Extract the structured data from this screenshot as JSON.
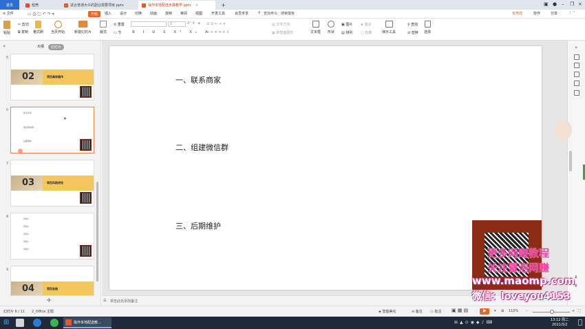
{
  "tabs": {
    "home": "首页",
    "tab1": "稻壳",
    "tab2": "适合普通大众的副业需要项目.pptx",
    "tab3": "操作本地配送步骤教学.pptx",
    "new_tab": "+"
  },
  "menu": {
    "file": "≡ 文件",
    "items": [
      "开始",
      "插入",
      "设计",
      "切换",
      "动画",
      "放映",
      "审阅",
      "视图",
      "开发工具",
      "会员专享"
    ],
    "search": "查找命令、搜索模板",
    "right": [
      "有修改",
      "协作",
      "分享"
    ]
  },
  "ribbon": {
    "paste": "粘贴",
    "cut": "剪切",
    "copy": "复制",
    "format_painter": "格式刷",
    "start_from_current": "当页开始",
    "new_slide": "新建幻灯片",
    "layout": "版式",
    "section": "节",
    "reset": "重置",
    "text_box": "文本框",
    "shape": "形状",
    "arrange": "排列",
    "picture": "图片",
    "fill": "填充",
    "outline": "轮廓",
    "presentation_tools": "演示工具",
    "find": "查找",
    "replace": "替换",
    "select": "选择",
    "font_placeholder": "",
    "size_placeholder": "0",
    "text_to_smartart": "转智能图形"
  },
  "panel": {
    "tab_outline": "大纲",
    "tab_slides": "幻灯片",
    "slides": [
      {
        "num": "5",
        "big": "02",
        "title": "项目具体操作"
      },
      {
        "num": "6",
        "lines": [
          "联系商家",
          "组建微信群",
          "后期维护"
        ]
      },
      {
        "num": "7",
        "big": "03",
        "title": "项目风险评估"
      },
      {
        "num": "8",
        "lines": [
          "风险1",
          "风险2",
          "风险3",
          "风险4",
          "风险5"
        ]
      },
      {
        "num": "9",
        "big": "04",
        "title": "项目总结"
      }
    ],
    "add": "+"
  },
  "slide": {
    "line1": "一、联系商家",
    "line2": "二、组建微信群",
    "line3": "三、后期维护"
  },
  "notes": {
    "placeholder": "单击此处添加备注"
  },
  "status": {
    "slide_index": "幻灯片 6 / 11",
    "theme": "2_Office 主题",
    "smart_beautify": "智能美化",
    "notes_btn": "备注",
    "comment_btn": "批注",
    "zoom": "110%"
  },
  "taskbar": {
    "app_label": "操作本地配送教...",
    "time": "13:12 周二",
    "date": "2021/3/2"
  },
  "watermark": {
    "line1": "更多网赚教程",
    "line2": "关注冒泡网赚",
    "line3": "www.maomp.com",
    "line4": "微信：loveyou4153"
  }
}
